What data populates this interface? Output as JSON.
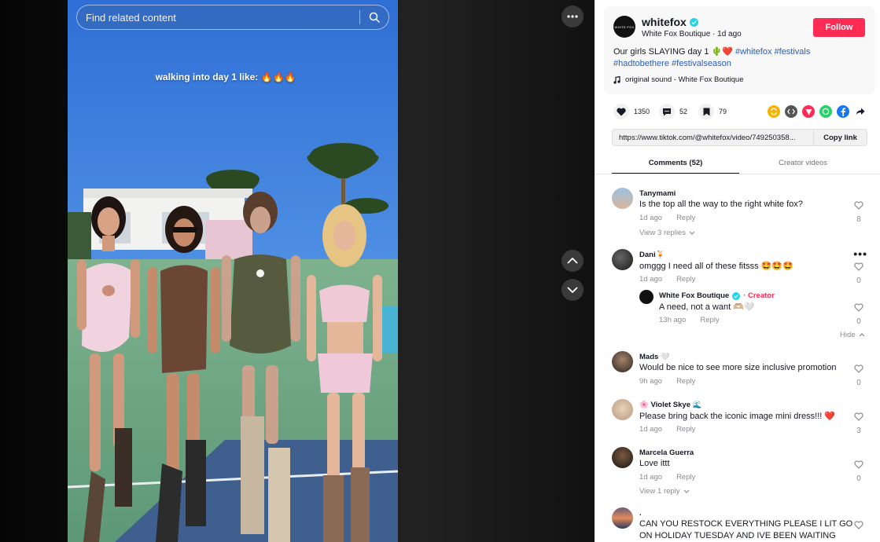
{
  "search": {
    "placeholder": "Find related content"
  },
  "video": {
    "caption": "walking into day 1 like: 🔥🔥🔥"
  },
  "author": {
    "avatar_text": "WHITE FOX",
    "username": "whitefox",
    "display_name": "White Fox Boutique",
    "posted": "1d ago",
    "follow_label": "Follow",
    "desc_text": "Our girls SLAYING day 1 🌵❤️",
    "hashtags": [
      "#whitefox",
      "#festivals",
      "#hadtobethere",
      "#festivalseason"
    ],
    "music": "original sound - White Fox Boutique"
  },
  "stats": {
    "likes": "1350",
    "comments": "52",
    "saves": "79"
  },
  "share_icons": [
    {
      "name": "repost-icon",
      "color": "#f5b400"
    },
    {
      "name": "embed-icon",
      "color": "#555555"
    },
    {
      "name": "send-icon",
      "color": "#fe2c55"
    },
    {
      "name": "whatsapp-icon",
      "color": "#25d366"
    },
    {
      "name": "facebook-icon",
      "color": "#1877f2"
    },
    {
      "name": "share-arrow-icon",
      "color": "#161823"
    }
  ],
  "link": {
    "url": "https://www.tiktok.com/@whitefox/video/749250358...",
    "copy_label": "Copy link"
  },
  "tabs": {
    "comments": "Comments (52)",
    "creator_videos": "Creator videos"
  },
  "comments": [
    {
      "user": "Tanymami",
      "text": "Is the top all the way to the right white fox?",
      "time": "1d ago",
      "reply": "Reply",
      "likes": "8",
      "view_replies": "View 3 replies"
    },
    {
      "user": "Dani🍹",
      "text": "omggg I need all of these fitsss 🤩🤩🤩",
      "time": "1d ago",
      "reply": "Reply",
      "likes": "0"
    },
    {
      "user": "White Fox Boutique",
      "creator": "· Creator",
      "text": "A need, not a want 🫶🏼🤍",
      "time": "13h ago",
      "reply": "Reply",
      "likes": "0"
    },
    {
      "user": "Mads 🤍",
      "text": "Would be nice to see more size inclusive promotion",
      "time": "9h ago",
      "reply": "Reply",
      "likes": "0"
    },
    {
      "user": "🌸 Violet Skye 🌊",
      "text": "Please bring back the iconic image mini dress!!! ❤️",
      "time": "1d ago",
      "reply": "Reply",
      "likes": "3"
    },
    {
      "user": "Marcela Guerra",
      "text": "Love ittt",
      "time": "1d ago",
      "reply": "Reply",
      "likes": "0",
      "view_replies": "View 1 reply"
    },
    {
      "user": ".",
      "text": "CAN YOU RESTOCK EVERYTHING PLEASE I LIT GO",
      "text2": "ON HOLIDAY TUESDAY AND IVE BEEN WAITING"
    }
  ],
  "hide_label": "Hide"
}
